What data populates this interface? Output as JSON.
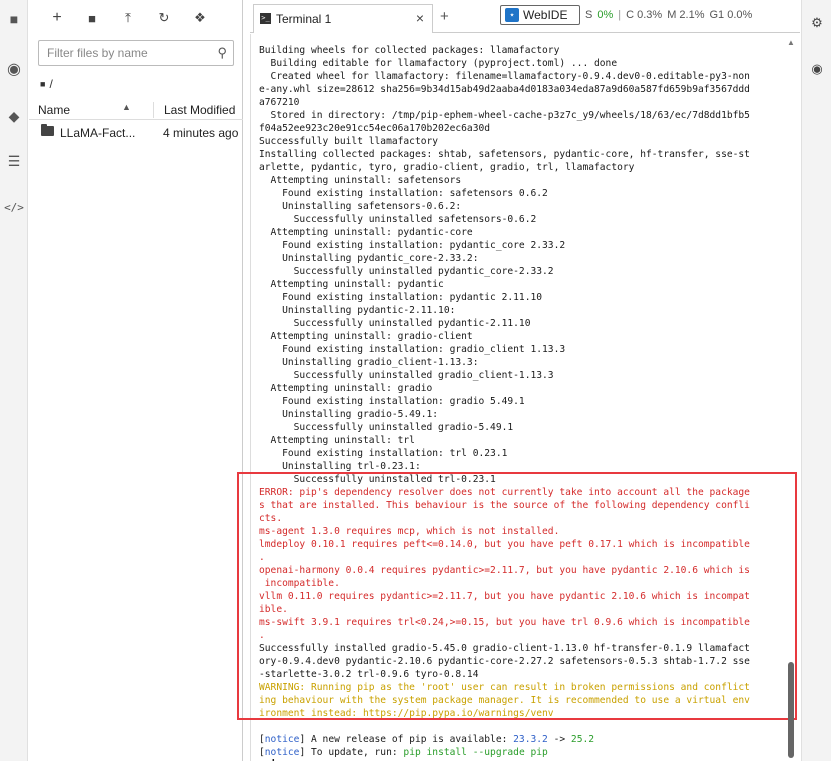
{
  "file_browser": {
    "filter_placeholder": "Filter files by name",
    "breadcrumb": "/",
    "columns": {
      "name": "Name",
      "last_modified": "Last Modified"
    },
    "files": [
      {
        "name": "LLaMA-Fact...",
        "modified": "4 minutes ago"
      }
    ]
  },
  "tab": {
    "title": "Terminal 1",
    "close": "×",
    "add": "+"
  },
  "toolbar": {
    "webide_label": "WebIDE",
    "status_small": "S",
    "status_percent": "0%",
    "cpu": "C 0.3%",
    "mem": "M 2.1%",
    "gpu": "G1 0.0%"
  },
  "terminal": {
    "lines": [
      {
        "t": "Building wheels for collected packages: llamafactory",
        "c": ""
      },
      {
        "t": "  Building editable for llamafactory (pyproject.toml) ... done",
        "c": ""
      },
      {
        "t": "  Created wheel for llamafactory: filename=llamafactory-0.9.4.dev0-0.editable-py3-non",
        "c": ""
      },
      {
        "t": "e-any.whl size=28612 sha256=9b34d15ab49d2aaba4d0183a034eda87a9d60a587fd659b9af3567ddd",
        "c": ""
      },
      {
        "t": "a767210",
        "c": ""
      },
      {
        "t": "  Stored in directory: /tmp/pip-ephem-wheel-cache-p3z7c_y9/wheels/18/63/ec/7d8dd1bfb5",
        "c": ""
      },
      {
        "t": "f04a52ee923c20e91cc54ec06a170b202ec6a30d",
        "c": ""
      },
      {
        "t": "Successfully built llamafactory",
        "c": ""
      },
      {
        "t": "Installing collected packages: shtab, safetensors, pydantic-core, hf-transfer, sse-st",
        "c": ""
      },
      {
        "t": "arlette, pydantic, tyro, gradio-client, gradio, trl, llamafactory",
        "c": ""
      },
      {
        "t": "  Attempting uninstall: safetensors",
        "c": ""
      },
      {
        "t": "    Found existing installation: safetensors 0.6.2",
        "c": ""
      },
      {
        "t": "    Uninstalling safetensors-0.6.2:",
        "c": ""
      },
      {
        "t": "      Successfully uninstalled safetensors-0.6.2",
        "c": ""
      },
      {
        "t": "  Attempting uninstall: pydantic-core",
        "c": ""
      },
      {
        "t": "    Found existing installation: pydantic_core 2.33.2",
        "c": ""
      },
      {
        "t": "    Uninstalling pydantic_core-2.33.2:",
        "c": ""
      },
      {
        "t": "      Successfully uninstalled pydantic_core-2.33.2",
        "c": ""
      },
      {
        "t": "  Attempting uninstall: pydantic",
        "c": ""
      },
      {
        "t": "    Found existing installation: pydantic 2.11.10",
        "c": ""
      },
      {
        "t": "    Uninstalling pydantic-2.11.10:",
        "c": ""
      },
      {
        "t": "      Successfully uninstalled pydantic-2.11.10",
        "c": ""
      },
      {
        "t": "  Attempting uninstall: gradio-client",
        "c": ""
      },
      {
        "t": "    Found existing installation: gradio_client 1.13.3",
        "c": ""
      },
      {
        "t": "    Uninstalling gradio_client-1.13.3:",
        "c": ""
      },
      {
        "t": "      Successfully uninstalled gradio_client-1.13.3",
        "c": ""
      },
      {
        "t": "  Attempting uninstall: gradio",
        "c": ""
      },
      {
        "t": "    Found existing installation: gradio 5.49.1",
        "c": ""
      },
      {
        "t": "    Uninstalling gradio-5.49.1:",
        "c": ""
      },
      {
        "t": "      Successfully uninstalled gradio-5.49.1",
        "c": ""
      },
      {
        "t": "  Attempting uninstall: trl",
        "c": ""
      },
      {
        "t": "    Found existing installation: trl 0.23.1",
        "c": ""
      },
      {
        "t": "    Uninstalling trl-0.23.1:",
        "c": ""
      },
      {
        "t": "      Successfully uninstalled trl-0.23.1",
        "c": ""
      },
      {
        "t": "ERROR: pip's dependency resolver does not currently take into account all the package",
        "c": "r"
      },
      {
        "t": "s that are installed. This behaviour is the source of the following dependency confli",
        "c": "r"
      },
      {
        "t": "cts.",
        "c": "r"
      },
      {
        "t": "ms-agent 1.3.0 requires mcp, which is not installed.",
        "c": "r"
      },
      {
        "t": "lmdeploy 0.10.1 requires peft<=0.14.0, but you have peft 0.17.1 which is incompatible",
        "c": "r"
      },
      {
        "t": ".",
        "c": "r"
      },
      {
        "t": "openai-harmony 0.0.4 requires pydantic>=2.11.7, but you have pydantic 2.10.6 which is",
        "c": "r"
      },
      {
        "t": " incompatible.",
        "c": "r"
      },
      {
        "t": "vllm 0.11.0 requires pydantic>=2.11.7, but you have pydantic 2.10.6 which is incompat",
        "c": "r"
      },
      {
        "t": "ible.",
        "c": "r"
      },
      {
        "t": "ms-swift 3.9.1 requires trl<0.24,>=0.15, but you have trl 0.9.6 which is incompatible",
        "c": "r"
      },
      {
        "t": ".",
        "c": "r"
      },
      {
        "t": "Successfully installed gradio-5.45.0 gradio-client-1.13.0 hf-transfer-0.1.9 llamafact",
        "c": ""
      },
      {
        "t": "ory-0.9.4.dev0 pydantic-2.10.6 pydantic-core-2.27.2 safetensors-0.5.3 shtab-1.7.2 sse",
        "c": ""
      },
      {
        "t": "-starlette-3.0.2 trl-0.9.6 tyro-0.8.14",
        "c": ""
      },
      {
        "t": "WARNING: Running pip as the 'root' user can result in broken permissions and conflict",
        "c": "y"
      },
      {
        "t": "ing behaviour with the system package manager. It is recommended to use a virtual env",
        "c": "y"
      },
      {
        "t": "ironment instead: https://pip.pypa.io/warnings/venv",
        "c": "y"
      },
      {
        "t": "",
        "c": ""
      }
    ],
    "notice1": {
      "tag": "notice",
      "text": " A new release of pip is available: ",
      "old": "23.3.2",
      "arrow": " -> ",
      "new": "25.2"
    },
    "notice2": {
      "tag": "notice",
      "text": " To update, run: ",
      "cmd": "pip install --upgrade pip"
    },
    "prompt": "# ┃"
  },
  "colors": {
    "error": "#d42b2b",
    "warning": "#c9a100",
    "highlight": "#e8393f",
    "notice": "#2f60c8",
    "ok": "#2a9d2a"
  }
}
